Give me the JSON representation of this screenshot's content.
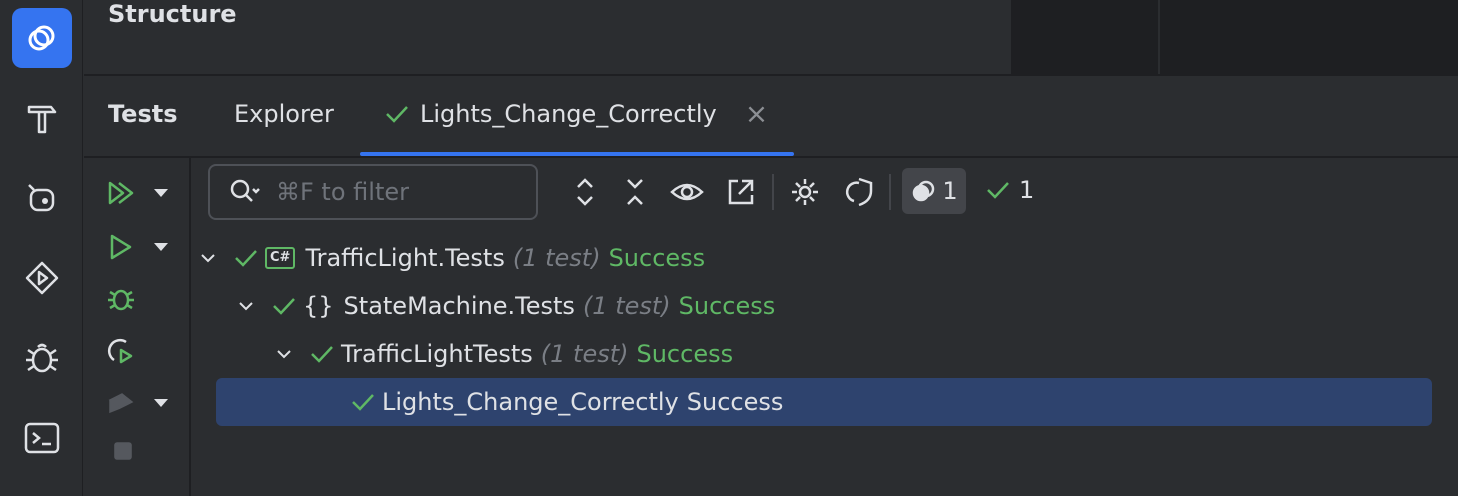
{
  "structure": {
    "title": "Structure"
  },
  "tabs": {
    "title": "Tests",
    "explorer_label": "Explorer",
    "active_label": "Lights_Change_Correctly",
    "close_glyph": "×"
  },
  "toolbar": {
    "filter_placeholder": "⌘F to filter",
    "running_count": "1",
    "passed_count": "1"
  },
  "tree": {
    "project": {
      "name": "TrafficLight.Tests",
      "count": "(1 test)",
      "status": "Success",
      "badge": "C#"
    },
    "namespace": {
      "name": "StateMachine.Tests",
      "count": "(1 test)",
      "status": "Success",
      "icon": "{}"
    },
    "class": {
      "name": "TrafficLightTests",
      "count": "(1 test)",
      "status": "Success"
    },
    "test": {
      "name": "Lights_Change_Correctly",
      "status": "Success"
    }
  },
  "colors": {
    "accent": "#3574f0",
    "success": "#5fb865",
    "selection": "#2e436e"
  }
}
